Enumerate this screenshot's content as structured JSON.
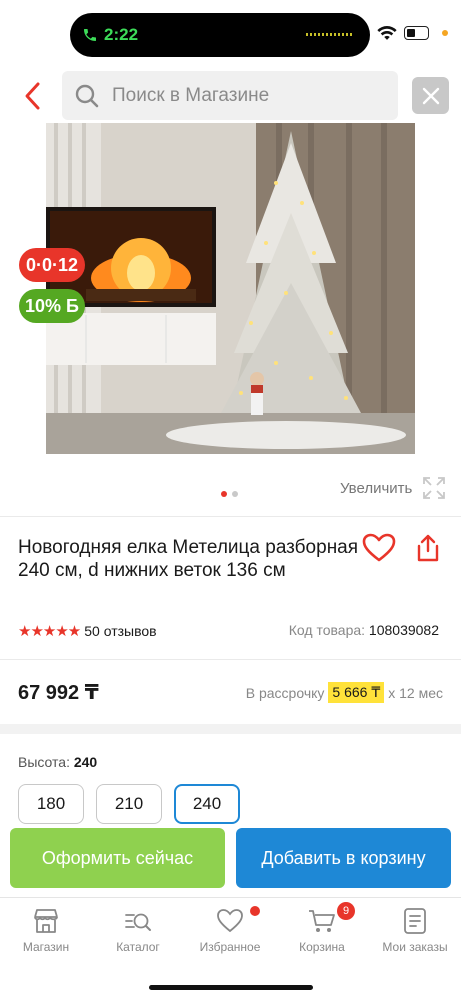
{
  "status": {
    "time": "2:22"
  },
  "search": {
    "placeholder": "Поиск в Магазине"
  },
  "badges": {
    "installment": "0·0·12",
    "bonus": "10% Б"
  },
  "gallery": {
    "zoom_label": "Увеличить"
  },
  "product": {
    "title": "Новогодняя елка Метелица разборная 240 см, d нижних веток 136 см",
    "stars": "★★★★★",
    "reviews": "50 отзывов",
    "code_label": "Код товара:",
    "code_value": "108039082",
    "price": "67 992 ₸",
    "installment_prefix": "В рассрочку",
    "installment_amount": "5 666 ₸",
    "installment_suffix": "х 12 мес"
  },
  "height": {
    "label": "Высота:",
    "value": "240",
    "options": [
      "180",
      "210",
      "240"
    ]
  },
  "actions": {
    "buy_now": "Оформить сейчас",
    "add_to_cart": "Добавить в корзину"
  },
  "tabbar": {
    "items": [
      {
        "label": "Магазин",
        "icon": "store-icon"
      },
      {
        "label": "Каталог",
        "icon": "catalog-search-icon"
      },
      {
        "label": "Избранное",
        "icon": "heart-icon"
      },
      {
        "label": "Корзина",
        "icon": "cart-icon"
      },
      {
        "label": "Мои заказы",
        "icon": "orders-icon"
      }
    ],
    "cart_count": "9"
  },
  "colors": {
    "accent_red": "#e8352a",
    "buy_now_green": "#8fd14f",
    "add_cart_blue": "#1e88d6",
    "installment_highlight": "#ffe23a"
  }
}
